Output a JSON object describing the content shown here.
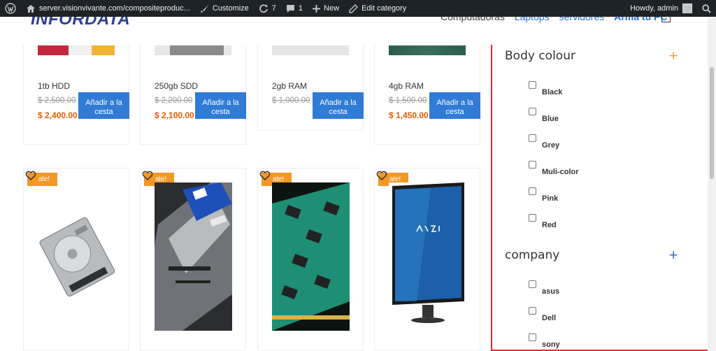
{
  "adminbar": {
    "site_url": "server.visionvivante.com/compositeproduc...",
    "customize": "Customize",
    "updates": "7",
    "comments": "1",
    "new": "New",
    "edit": "Edit category",
    "howdy": "Howdy, admin"
  },
  "header": {
    "logo": "INFORDATA",
    "nav": [
      "Computadoras",
      "Laptops",
      "servidores",
      "Arma tu PC"
    ]
  },
  "products_top": [
    {
      "name": "1tb HDD",
      "old_price": "$ 2,500.00",
      "new_price": "$ 2,400.00",
      "button": "Añadir a la cesta"
    },
    {
      "name": "250gb SDD",
      "old_price": "$ 2,200.00",
      "new_price": "$ 2,100.00",
      "button": "Añadir a la cesta"
    },
    {
      "name": "2gb RAM",
      "old_price": "$ 1,000.00",
      "new_price": "",
      "button": "Añadir a la cesta"
    },
    {
      "name": "4gb RAM",
      "old_price": "$ 1,500.00",
      "new_price": "$ 1,450.00",
      "button": "Añadir a la cesta"
    }
  ],
  "products_bottom": [
    {
      "badge": "ale!"
    },
    {
      "badge": "ale!"
    },
    {
      "badge": "ale!"
    },
    {
      "badge": "ale!"
    }
  ],
  "filter": {
    "groups": [
      {
        "title": "Body colour",
        "toggle": "+",
        "toggle_color": "#f29824",
        "options": [
          "Black",
          "Blue",
          "Grey",
          "Muli-color",
          "Pink",
          "Red"
        ]
      },
      {
        "title": "company",
        "toggle": "+",
        "toggle_color": "#2a5fa8",
        "options": [
          "asus",
          "Dell",
          "sony"
        ]
      }
    ]
  },
  "colors": {
    "accent_orange": "#f29824",
    "price_orange": "#e65c00",
    "button_blue": "#2f7bd6",
    "highlight_red": "#e8272f"
  }
}
